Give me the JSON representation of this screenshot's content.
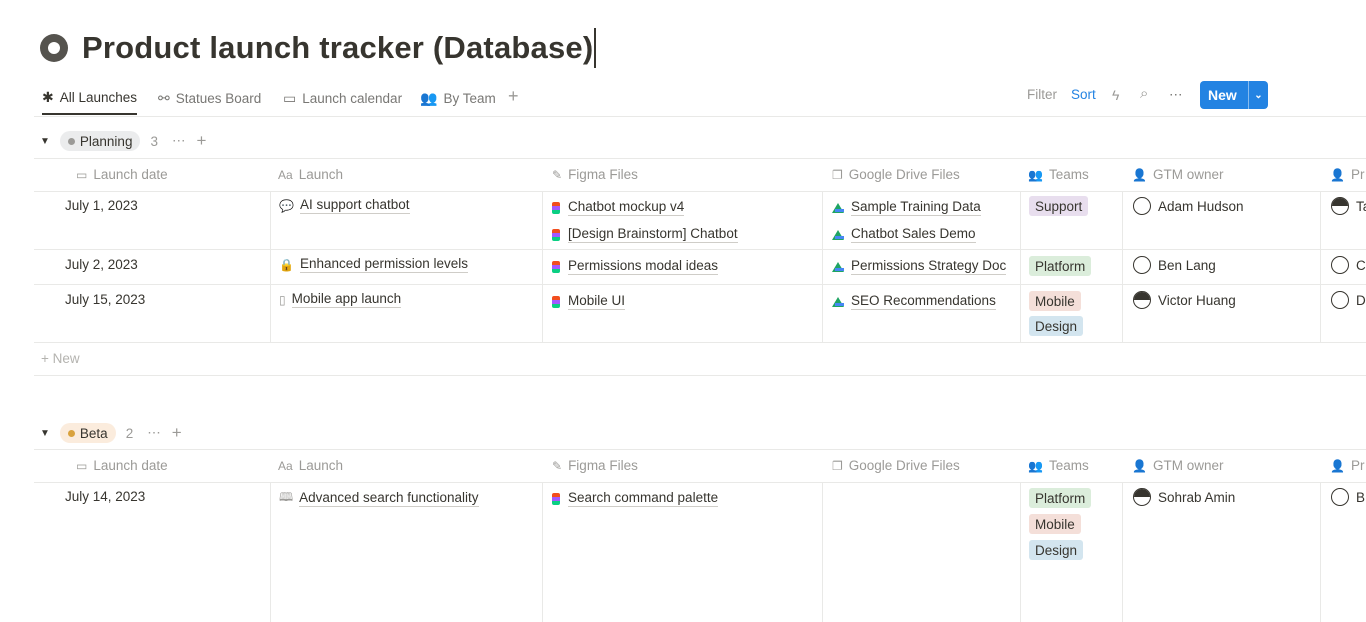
{
  "page": {
    "title": "Product launch tracker (Database)"
  },
  "tabs": [
    {
      "label": "All Launches",
      "icon": "asterisk-icon"
    },
    {
      "label": "Statues Board",
      "icon": "board-icon"
    },
    {
      "label": "Launch calendar",
      "icon": "calendar-icon"
    },
    {
      "label": "By Team",
      "icon": "team-icon"
    }
  ],
  "toolbar": {
    "filter": "Filter",
    "sort": "Sort",
    "new": "New",
    "more": "⋯"
  },
  "columns": {
    "launch_date": "Launch date",
    "launch": "Launch",
    "launch_prefix": "Aa",
    "figma": "Figma Files",
    "gdrive": "Google Drive Files",
    "teams": "Teams",
    "gtm": "GTM owner",
    "pr": "Pr"
  },
  "groups": {
    "planning": {
      "label": "Planning",
      "count": "3",
      "color": "#9b9a97",
      "rows": [
        {
          "date": "July 1, 2023",
          "launch": "AI support chatbot",
          "figma": [
            "Chatbot mockup v4",
            "[Design Brainstorm] Chatbot"
          ],
          "drive": [
            "Sample Training Data",
            "Chatbot Sales Demo"
          ],
          "teams": [
            "Support"
          ],
          "gtm": "Adam Hudson",
          "pr": "Ta"
        },
        {
          "date": "July 2, 2023",
          "launch": "Enhanced permission levels",
          "figma": [
            "Permissions modal ideas"
          ],
          "drive": [
            "Permissions Strategy Doc"
          ],
          "teams": [
            "Platform"
          ],
          "gtm": "Ben Lang",
          "pr": "C"
        },
        {
          "date": "July 15, 2023",
          "launch": "Mobile app launch",
          "figma": [
            "Mobile UI"
          ],
          "drive": [
            "SEO Recommendations"
          ],
          "teams": [
            "Mobile",
            "Design"
          ],
          "gtm": "Victor Huang",
          "pr": "D"
        }
      ],
      "new_label": "+ New"
    },
    "beta": {
      "label": "Beta",
      "count": "2",
      "color": "#d9a23d",
      "rows": [
        {
          "date": "July 14, 2023",
          "launch": "Advanced search functionality",
          "figma": [
            "Search command palette"
          ],
          "drive": [],
          "teams": [
            "Platform",
            "Mobile",
            "Design"
          ],
          "gtm": "Sohrab Amin",
          "pr": "B"
        }
      ]
    }
  }
}
